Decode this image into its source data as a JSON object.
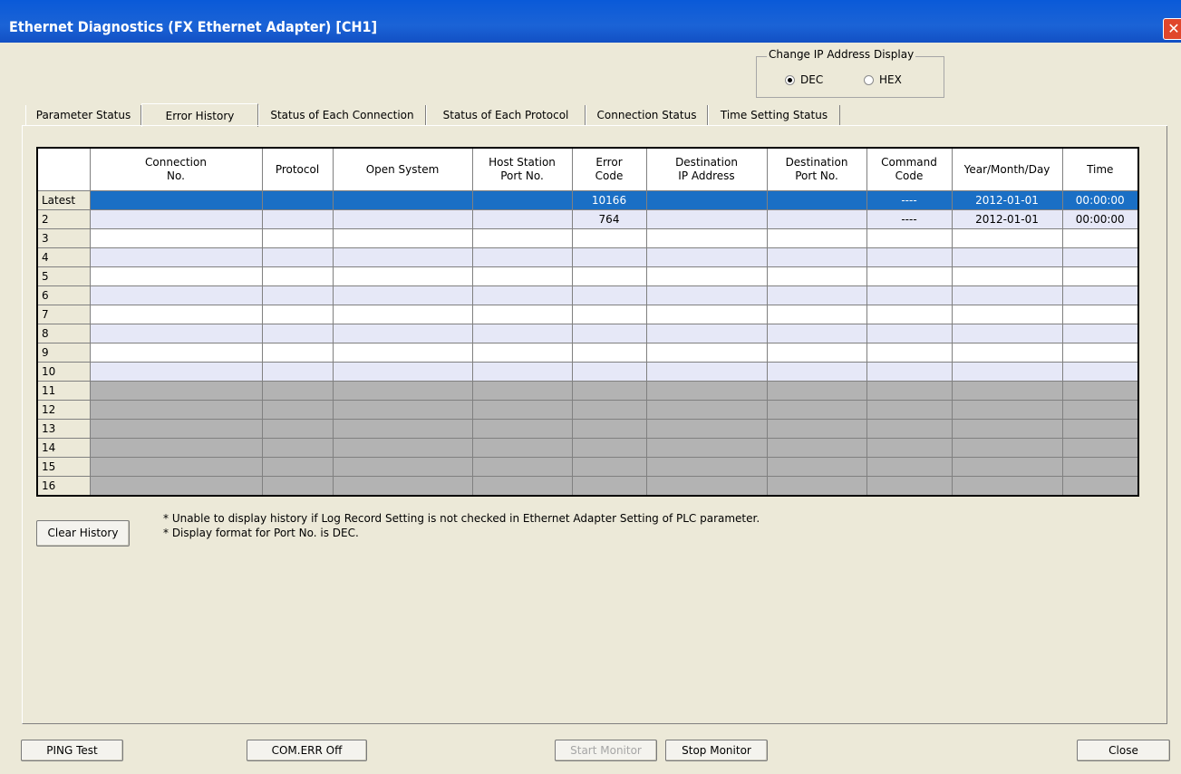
{
  "window": {
    "title": "Ethernet Diagnostics (FX Ethernet Adapter) [CH1]",
    "close_glyph": "✕"
  },
  "ip_display": {
    "legend": "Change IP Address Display",
    "options": [
      "DEC",
      "HEX"
    ],
    "selected": "DEC"
  },
  "tabs": [
    "Parameter Status",
    "Error History",
    "Status of Each Connection",
    "Status of Each Protocol",
    "Connection Status",
    "Time Setting Status"
  ],
  "active_tab": "Error History",
  "table": {
    "headers": [
      "Connection\nNo.",
      "Protocol",
      "Open System",
      "Host Station\nPort No.",
      "Error\nCode",
      "Destination\nIP Address",
      "Destination\nPort No.",
      "Command\nCode",
      "Year/Month/Day",
      "Time"
    ],
    "rows": [
      {
        "label": "Latest",
        "cells": [
          "",
          "",
          "",
          "",
          "10166",
          "",
          "",
          "----",
          "2012-01-01",
          "00:00:00"
        ]
      },
      {
        "label": "2",
        "cells": [
          "",
          "",
          "",
          "",
          "764",
          "",
          "",
          "----",
          "2012-01-01",
          "00:00:00"
        ]
      },
      {
        "label": "3",
        "cells": [
          "",
          "",
          "",
          "",
          "",
          "",
          "",
          "",
          "",
          ""
        ]
      },
      {
        "label": "4",
        "cells": [
          "",
          "",
          "",
          "",
          "",
          "",
          "",
          "",
          "",
          ""
        ]
      },
      {
        "label": "5",
        "cells": [
          "",
          "",
          "",
          "",
          "",
          "",
          "",
          "",
          "",
          ""
        ]
      },
      {
        "label": "6",
        "cells": [
          "",
          "",
          "",
          "",
          "",
          "",
          "",
          "",
          "",
          ""
        ]
      },
      {
        "label": "7",
        "cells": [
          "",
          "",
          "",
          "",
          "",
          "",
          "",
          "",
          "",
          ""
        ]
      },
      {
        "label": "8",
        "cells": [
          "",
          "",
          "",
          "",
          "",
          "",
          "",
          "",
          "",
          ""
        ]
      },
      {
        "label": "9",
        "cells": [
          "",
          "",
          "",
          "",
          "",
          "",
          "",
          "",
          "",
          ""
        ]
      },
      {
        "label": "10",
        "cells": [
          "",
          "",
          "",
          "",
          "",
          "",
          "",
          "",
          "",
          ""
        ]
      },
      {
        "label": "11",
        "cells": [
          "",
          "",
          "",
          "",
          "",
          "",
          "",
          "",
          "",
          ""
        ]
      },
      {
        "label": "12",
        "cells": [
          "",
          "",
          "",
          "",
          "",
          "",
          "",
          "",
          "",
          ""
        ]
      },
      {
        "label": "13",
        "cells": [
          "",
          "",
          "",
          "",
          "",
          "",
          "",
          "",
          "",
          ""
        ]
      },
      {
        "label": "14",
        "cells": [
          "",
          "",
          "",
          "",
          "",
          "",
          "",
          "",
          "",
          ""
        ]
      },
      {
        "label": "15",
        "cells": [
          "",
          "",
          "",
          "",
          "",
          "",
          "",
          "",
          "",
          ""
        ]
      },
      {
        "label": "16",
        "cells": [
          "",
          "",
          "",
          "",
          "",
          "",
          "",
          "",
          "",
          ""
        ]
      }
    ]
  },
  "clear_history_label": "Clear History",
  "notes": [
    "* Unable to display history if Log Record Setting is not checked in Ethernet Adapter Setting of PLC parameter.",
    "* Display format for Port No. is DEC."
  ],
  "buttons": {
    "ping_test": "PING Test",
    "com_err_off": "COM.ERR Off",
    "start_monitor": "Start Monitor",
    "stop_monitor": "Stop Monitor",
    "close": "Close"
  },
  "colors": {
    "title_bar": "#0a5ad8",
    "selected_row": "#1a6fc5",
    "alt_row": "#e6e8f7",
    "inactive_row": "#b3b3b3",
    "dialog_bg": "#ece9d8"
  }
}
